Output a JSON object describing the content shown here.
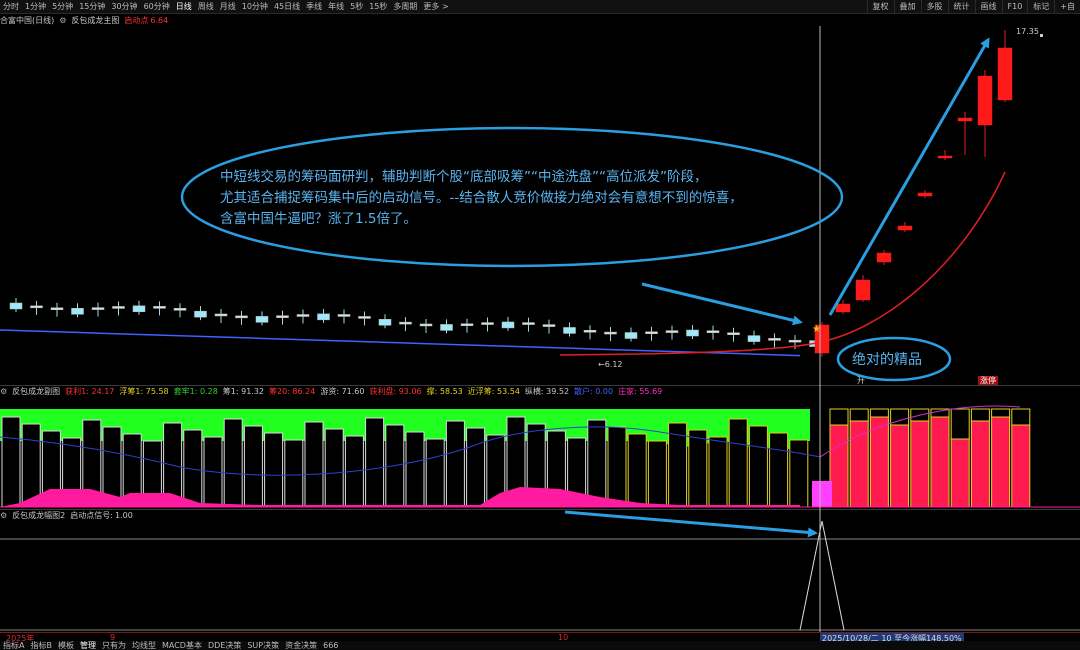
{
  "toolbar": {
    "periods": [
      "分时",
      "1分钟",
      "5分钟",
      "15分钟",
      "30分钟",
      "60分钟",
      "日线",
      "周线",
      "月线",
      "10分钟",
      "45日线",
      "季线",
      "年线",
      "5秒",
      "15秒",
      "多周期",
      "更多 >"
    ],
    "active_period": "日线",
    "right_buttons": [
      "复权",
      "叠加",
      "多股",
      "统计",
      "画线",
      "F10",
      "标记",
      "+自"
    ]
  },
  "main_header": {
    "stock": "合富中国(日线)",
    "indicator": "反包成龙主图",
    "signal_label": "启动点",
    "signal_value": "6.64"
  },
  "price_labels": {
    "high": "17.35",
    "low": "6.12"
  },
  "annotation": {
    "line1": "中短线交易的筹码面研判，辅助判断个股“底部吸筹”“中途洗盘”“高位派发”阶段，",
    "line2": "尤其适合捕捉筹码集中后的启动信号。--结合散人竞价做接力绝对会有意想不到的惊喜，",
    "line3": "含富中国牛逼吧？涨了1.5倍了。",
    "bubble": "绝对的精品"
  },
  "tags": {
    "kai": "开",
    "zhangting": "涨停"
  },
  "panel2_header": {
    "title": "反包成龙副图",
    "items": [
      {
        "label": "获利1:",
        "value": "24.17",
        "color": "#ff3030"
      },
      {
        "label": "浮筹1:",
        "value": "75.58",
        "color": "#e0d020"
      },
      {
        "label": "套牢1:",
        "value": "0.28",
        "color": "#30d030"
      },
      {
        "label": "筹1:",
        "value": "91.32",
        "color": "#c8c8c8"
      },
      {
        "label": "筹20:",
        "value": "86.24",
        "color": "#ff3030"
      },
      {
        "label": "游资:",
        "value": "71.60",
        "color": "#c8c8c8"
      },
      {
        "label": "获利盘:",
        "value": "93.06",
        "color": "#ff3030"
      },
      {
        "label": "撑:",
        "value": "58.53",
        "color": "#e0d020"
      },
      {
        "label": "近浮筹:",
        "value": "53.54",
        "color": "#e0d020"
      },
      {
        "label": "纵横:",
        "value": "39.52",
        "color": "#c8c8c8"
      },
      {
        "label": "散户:",
        "value": "0.00",
        "color": "#4060ff"
      },
      {
        "label": "庄家:",
        "value": "55.69",
        "color": "#ff30c0"
      }
    ]
  },
  "panel3_header": {
    "title": "反包成龙幅图2",
    "signal_label": "启动点信号:",
    "signal_value": "1.00"
  },
  "time_axis": {
    "labels": [
      "2025年",
      "9",
      "10"
    ],
    "selected": "2025/10/28/二 10 至今涨幅148.50%"
  },
  "bottom_tabs": [
    "指标A",
    "指标B",
    "模板",
    "管理",
    "只有为",
    "均线型",
    "MACD基本",
    "DDE决策",
    "SUP决策",
    "资金决策",
    "666"
  ],
  "bottom_active": "管理",
  "chart_data": {
    "type": "candlestick",
    "last_candles_close": [
      6.64,
      7.3,
      8.03,
      8.83,
      9.71,
      10.68,
      11.75,
      12.93,
      14.22,
      15.64,
      17.2
    ],
    "high": 17.35,
    "low": 6.12,
    "signal_date": "2025/10/28",
    "gain_since": "148.50%"
  }
}
